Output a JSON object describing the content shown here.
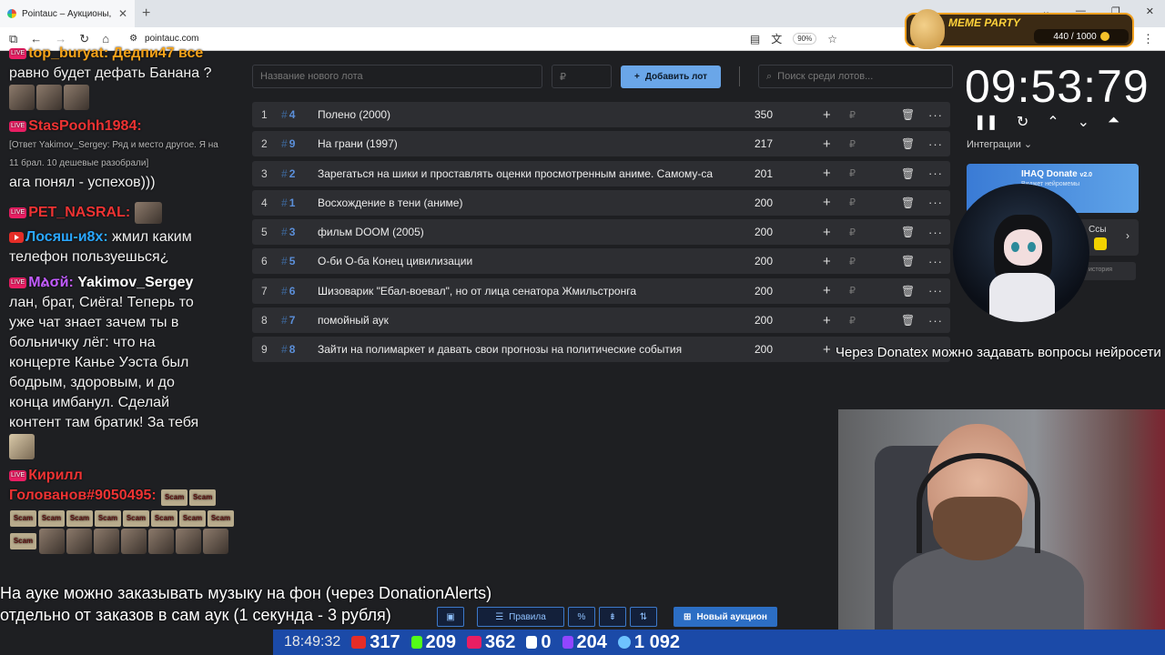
{
  "browser": {
    "tab_title": "Pointauc – Аукционы, лотереи",
    "url": "pointauc.com",
    "zoom": "90%"
  },
  "overlay": {
    "meme_title": "MEME PARTY",
    "meme_counter": "440 / 1000",
    "tts_ticker": "Через Donatex можно задавать вопросы нейросети",
    "subtitle_line1": "На ауке можно заказывать музыку на фон (через DonationAlerts)",
    "subtitle_line2": "отдельно от заказов в сам аук (1 секунда - 3 рубля)"
  },
  "chat": {
    "l1": "top_buryat: Дедпи47 все",
    "l2": "равно будет дефать Банана ?",
    "n1": "StasPoohh1984:",
    "reply1": "[Ответ Yakimov_Sergey: Ряд и место другое. Я на",
    "reply2": "11 брал. 10 дешевые разобрали]",
    "t1": "ага понял - успехов)))",
    "n2": "PET_NASRAL:",
    "n3": "Лосяш-и8х:",
    "t3a": "жмил каким",
    "t3b": "телефон пользуешься¿",
    "n4": "Мልσй:",
    "n4b": "Yakimov_Sergey",
    "t4": [
      "лан, брат, Сиёга! Теперь то",
      "уже чат знает зачем ты в",
      "больничку лёг: что на",
      "концерте Канье Уэста был",
      "бодрым, здоровым, и до",
      "конца имбанул. Сделай",
      "контент там братик! За тебя"
    ],
    "n5a": "Кирилл",
    "n5b": "Голованов#9050495:",
    "scam": "Scam"
  },
  "app": {
    "name_placeholder": "Название нового лота",
    "amount_placeholder": "₽",
    "add_button": "Добавить лот",
    "search_placeholder": "Поиск среди лотов...",
    "currency": "₽",
    "lots": [
      {
        "n": "1",
        "id": "4",
        "name": "Полено (2000)",
        "amount": "350"
      },
      {
        "n": "2",
        "id": "9",
        "name": "На грани (1997)",
        "amount": "217"
      },
      {
        "n": "3",
        "id": "2",
        "name": "Зарегаться на шики и проставлять оценки просмотренным аниме. Самому-са",
        "amount": "201"
      },
      {
        "n": "4",
        "id": "1",
        "name": "Восхождение в тени (аниме)",
        "amount": "200"
      },
      {
        "n": "5",
        "id": "3",
        "name": "фильм DOOM (2005)",
        "amount": "200"
      },
      {
        "n": "6",
        "id": "5",
        "name": "О-би О-ба Конец цивилизации",
        "amount": "200"
      },
      {
        "n": "7",
        "id": "6",
        "name": "Шизоварик \"Ебал-воевал\", но от лица сенатора Жмильстронга",
        "amount": "200"
      },
      {
        "n": "8",
        "id": "7",
        "name": "помойный аук",
        "amount": "200"
      },
      {
        "n": "9",
        "id": "8",
        "name": "Зайти на полимаркет и давать свои прогнозы на политические события",
        "amount": "200"
      }
    ],
    "timer": "09:53:79",
    "integrations_label": "Интеграции",
    "donate_title": "IHAQ Donate",
    "donate_version": "v2.0",
    "donate_sub": "Виджет нейромемы",
    "card2_label": "Ссы",
    "card3_label": "история",
    "rules_button": "Правила",
    "new_auction_button": "Новый аукцион"
  },
  "stats": {
    "time": "18:49:32",
    "youtube": "317",
    "kick": "209",
    "vkplay": "362",
    "rumble": "0",
    "twitch": "204",
    "total": "1 092"
  }
}
